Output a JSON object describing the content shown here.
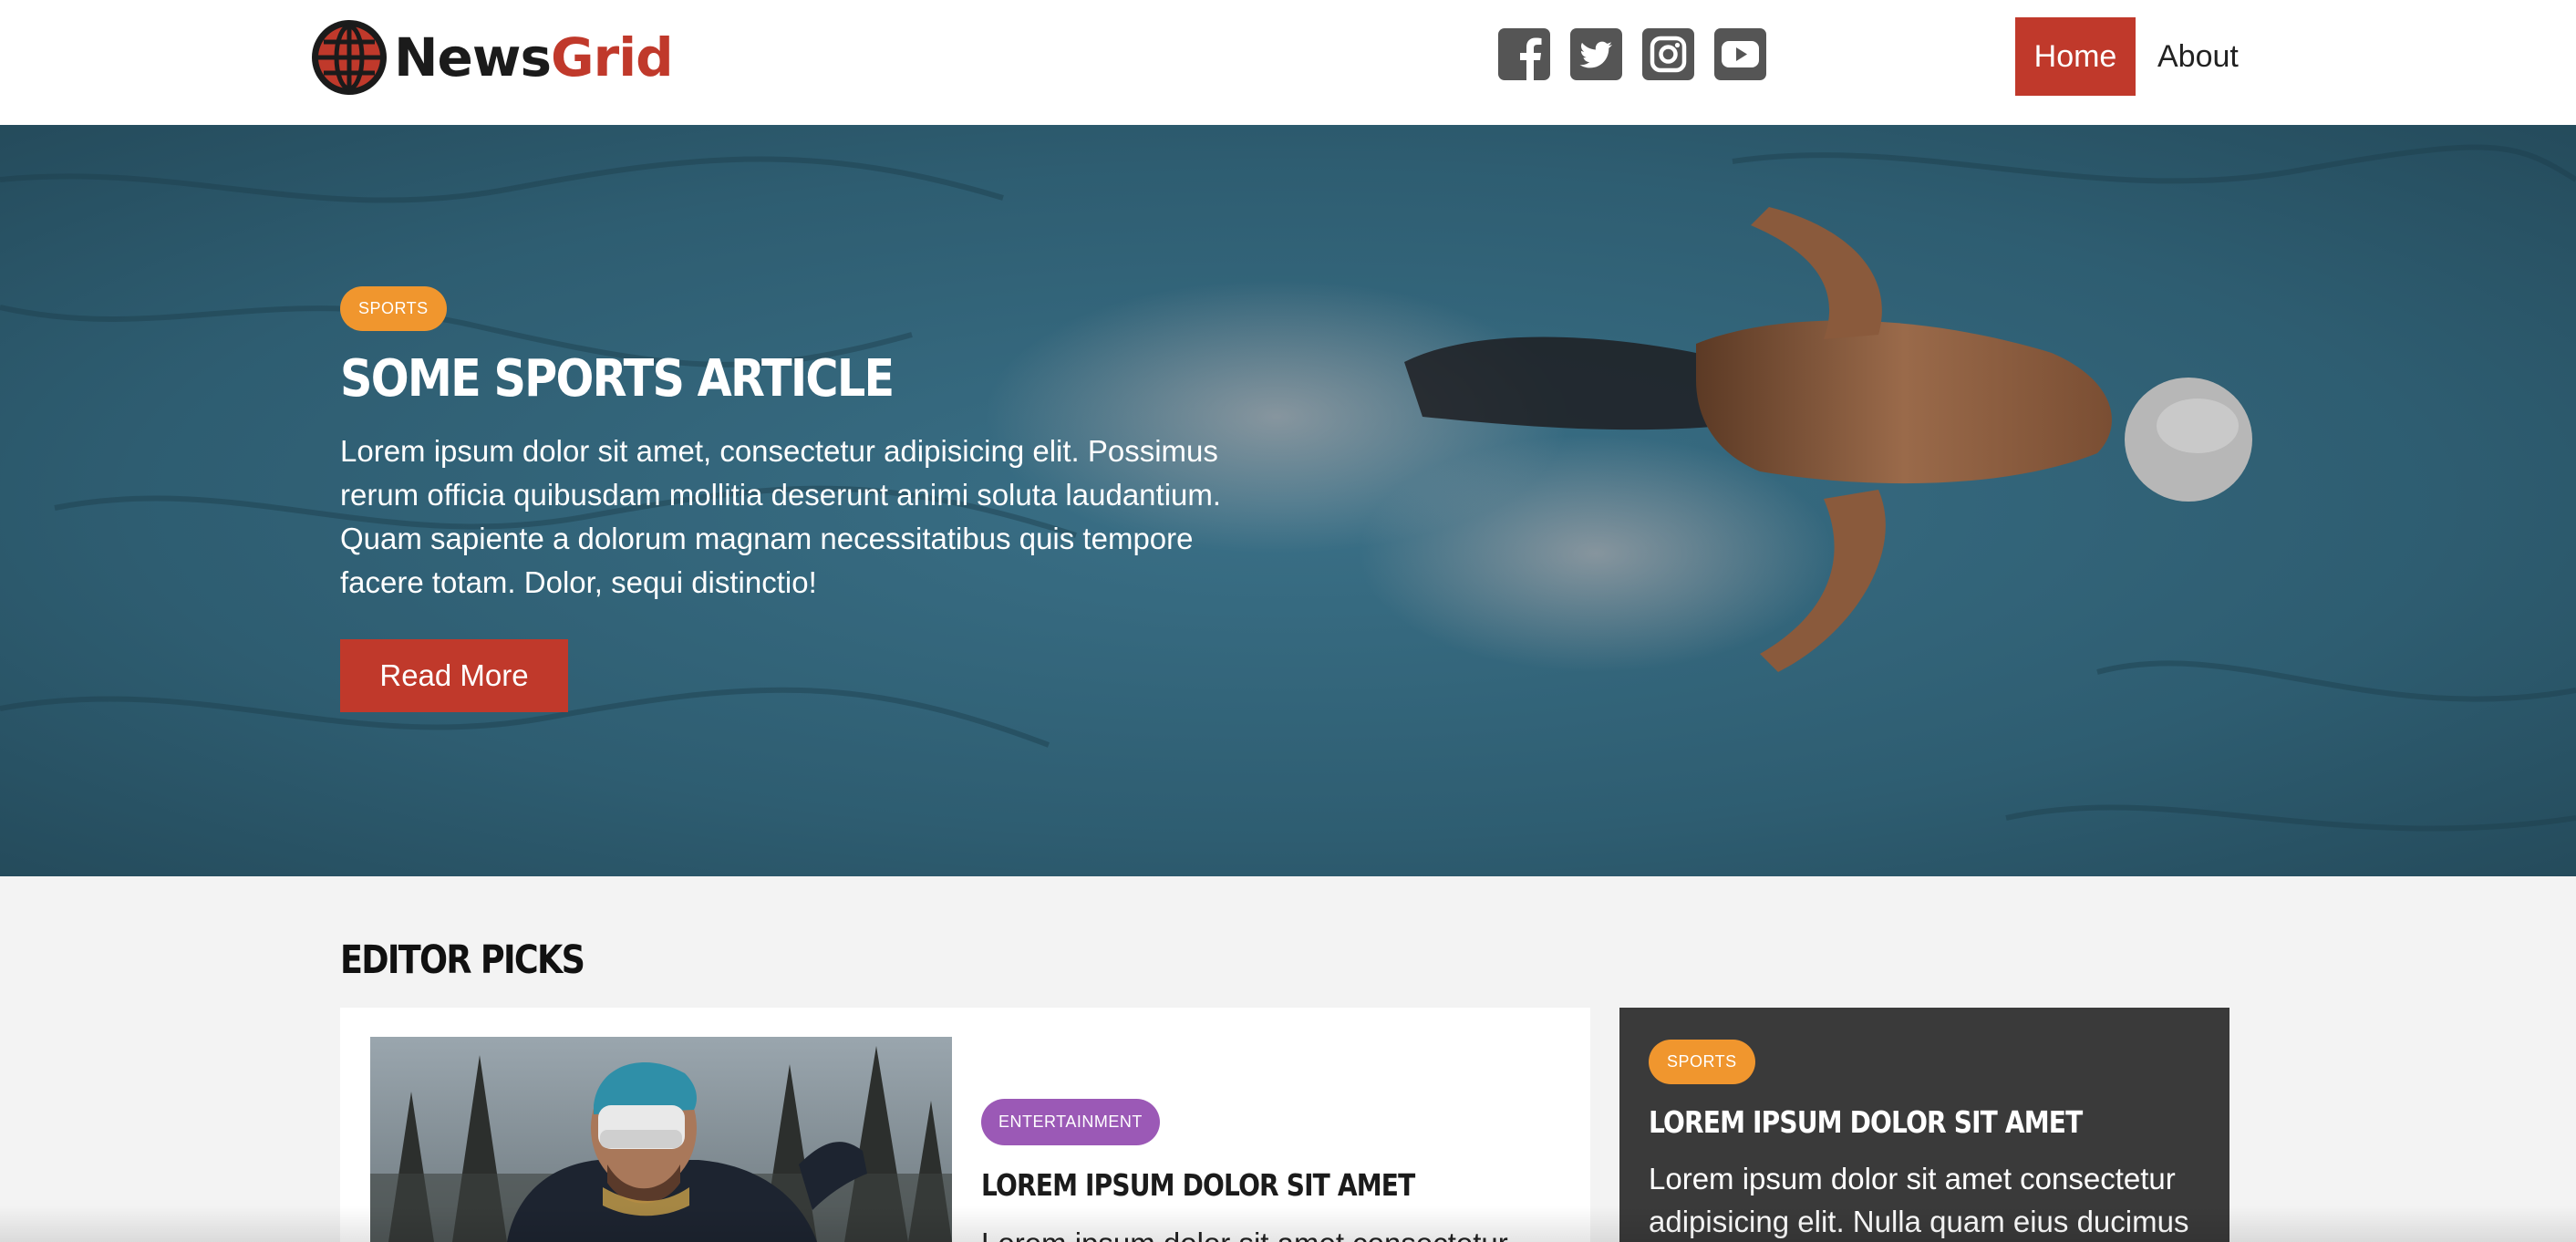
{
  "brand": {
    "name_part1": "News",
    "name_part2": "Grid",
    "accent_color": "#c0392b",
    "icon": "globe-icon"
  },
  "social": {
    "links": [
      {
        "icon": "facebook-icon"
      },
      {
        "icon": "twitter-icon"
      },
      {
        "icon": "instagram-icon"
      },
      {
        "icon": "youtube-icon"
      }
    ]
  },
  "nav": {
    "items": [
      {
        "label": "Home",
        "active": true
      },
      {
        "label": "About",
        "active": false
      }
    ]
  },
  "hero": {
    "category": "SPORTS",
    "category_color": "#f0962e",
    "title": "SOME SPORTS ARTICLE",
    "text": "Lorem ipsum dolor sit amet, consectetur adipisicing elit. Possimus rerum officia quibusdam mollitia deserunt animi soluta laudantium. Quam sapiente a dolorum magnam necessitatibus quis tempore facere totam. Dolor, sequi distinctio!",
    "button_label": "Read More"
  },
  "editor_picks": {
    "heading": "EDITOR PICKS",
    "main_card": {
      "category": "ENTERTAINMENT",
      "category_color": "#9b59b6",
      "title": "LOREM IPSUM DOLOR SIT AMET",
      "text": "Lorem ipsum dolor sit amet consectetur"
    },
    "side_card": {
      "category": "SPORTS",
      "category_color": "#f0962e",
      "title": "LOREM IPSUM DOLOR SIT AMET",
      "text": "Lorem ipsum dolor sit amet consectetur adipisicing elit. Nulla quam eius ducimus"
    }
  }
}
